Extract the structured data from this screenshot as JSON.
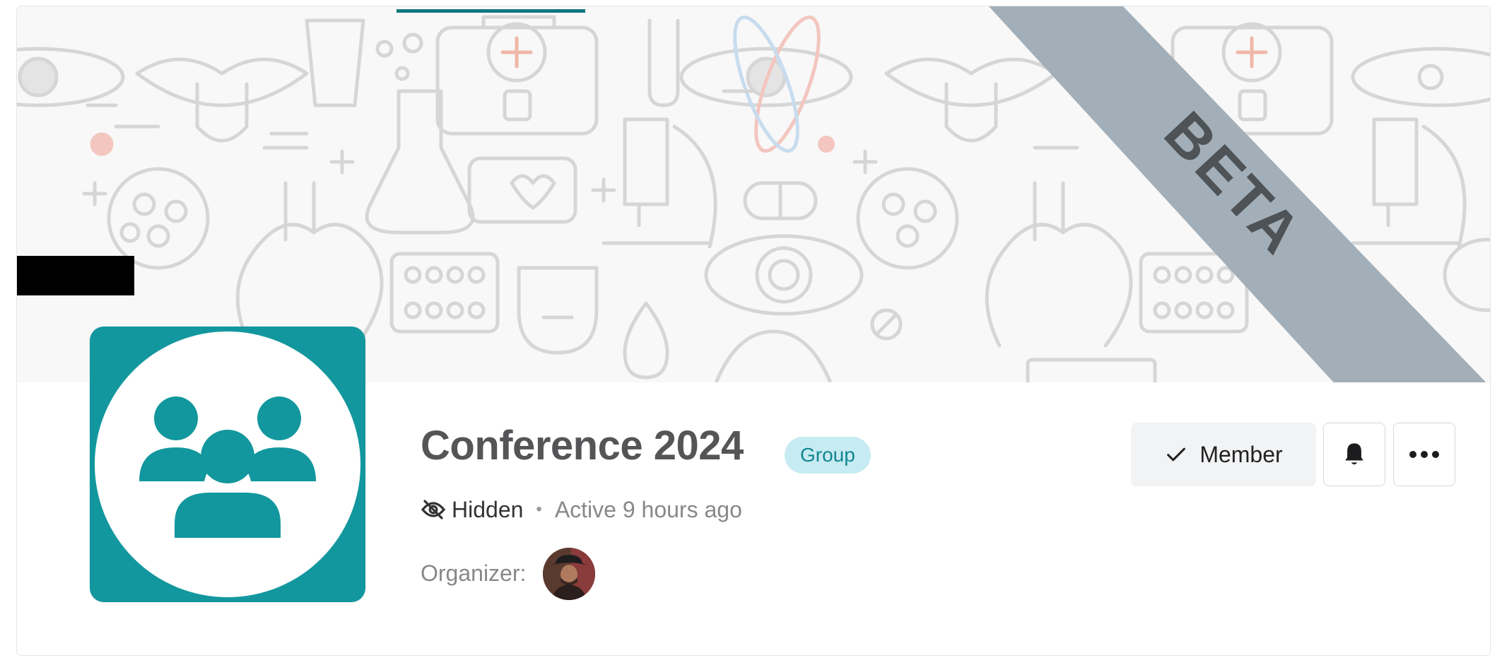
{
  "cover": {
    "ribbon_text": "BETA"
  },
  "group": {
    "title": "Conference 2024",
    "type_badge": "Group",
    "visibility": "Hidden",
    "activity": "Active 9 hours ago",
    "organizer_label": "Organizer:"
  },
  "actions": {
    "member_label": "Member"
  },
  "colors": {
    "brand_teal": "#13979e",
    "badge_bg": "#c7ebf2",
    "badge_text": "#13868f",
    "ribbon": "#a3afb8"
  }
}
